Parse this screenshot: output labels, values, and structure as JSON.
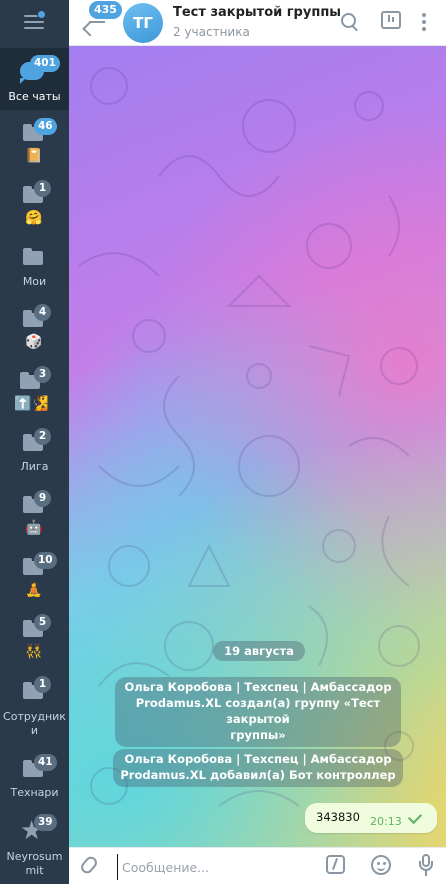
{
  "sidebar": {
    "folders": [
      {
        "name": "all",
        "label": "Все чаты",
        "badge": "401",
        "icon": "chats-icon"
      },
      {
        "name": "folder-2",
        "label": "",
        "badge": "46",
        "emoji": "📔",
        "icon": "folder-icon"
      },
      {
        "name": "folder-3",
        "label": "",
        "badge": "1",
        "emoji": "🤗",
        "icon": "folder-icon"
      },
      {
        "name": "moi",
        "label": "Мои",
        "badge": "",
        "icon": "folder-icon"
      },
      {
        "name": "folder-5",
        "label": "",
        "badge": "4",
        "emoji": "🎲",
        "icon": "folder-icon"
      },
      {
        "name": "folder-6",
        "label": "",
        "badge": "3",
        "emoji": "⬆️🧏",
        "icon": "folder-icon"
      },
      {
        "name": "liga",
        "label": "Лига",
        "badge": "2",
        "icon": "folder-icon"
      },
      {
        "name": "folder-8",
        "label": "",
        "badge": "9",
        "emoji": "🤖",
        "icon": "folder-icon"
      },
      {
        "name": "folder-9",
        "label": "",
        "badge": "10",
        "emoji": "🧘",
        "icon": "folder-icon"
      },
      {
        "name": "folder-10",
        "label": "",
        "badge": "5",
        "emoji": "👯",
        "icon": "folder-icon"
      },
      {
        "name": "sotrudniki",
        "label": "Сотрудники",
        "badge": "1",
        "icon": "folder-icon"
      },
      {
        "name": "tehnari",
        "label": "Технари",
        "badge": "41",
        "icon": "folder-icon"
      },
      {
        "name": "neyrosummit",
        "label": "Neyrosummit",
        "badge": "39",
        "icon": "star-icon"
      }
    ]
  },
  "header": {
    "back_badge": "435",
    "avatar_initials": "ТГ",
    "title": "Тест закрытой группы",
    "subtitle": "2 участника"
  },
  "chat": {
    "date": "19 августа",
    "service_messages": [
      {
        "line1": "Ольга Коробова | Техспец | Амбассадор",
        "line2": "Prodamus.XL создал(а) группу «Тест закрытой",
        "line3": "группы»"
      },
      {
        "line1": "Ольга Коробова | Техспец | Амбассадор",
        "line2": "Prodamus.XL добавил(а) Бот контроллер"
      }
    ],
    "outgoing_message": {
      "text": "343830",
      "time": "20:13"
    }
  },
  "composer": {
    "placeholder": "Сообщение..."
  },
  "colors": {
    "sidebar_bg": "#2b3a4b",
    "accent": "#4fa3e0",
    "outgoing_bubble": "#effdde"
  }
}
